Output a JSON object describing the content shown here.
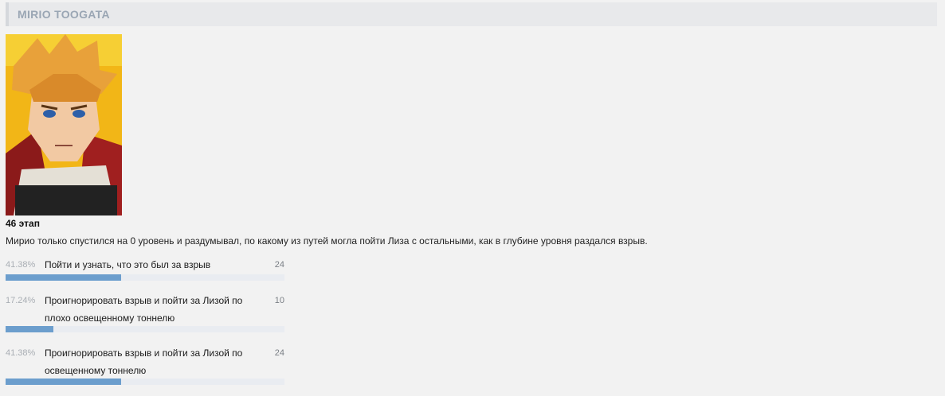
{
  "header": {
    "title": "MIRIO TOOGATA"
  },
  "post": {
    "stage": "46 этап",
    "description": "Мирио только спустился на 0 уровень и раздумывал, по какому из путей могла пойти Лиза с остальными, как в глубине уровня раздался взрыв."
  },
  "poll": {
    "options": [
      {
        "percent": "41.38%",
        "label": "Пойти и узнать, что это был за взрыв",
        "votes": "24",
        "share": 0.4138
      },
      {
        "percent": "17.24%",
        "label": "Проигнорировать взрыв и пойти за Лизой по плохо освещенному тоннелю",
        "votes": "10",
        "share": 0.1724
      },
      {
        "percent": "41.38%",
        "label": "Проигнорировать взрыв и пойти за Лизой по освещенному тоннелю",
        "votes": "24",
        "share": 0.4138
      }
    ]
  },
  "colors": {
    "bar_fill": "#6c9ecd",
    "bar_track": "#e9ecf1",
    "header_text": "#9aa6b4"
  }
}
